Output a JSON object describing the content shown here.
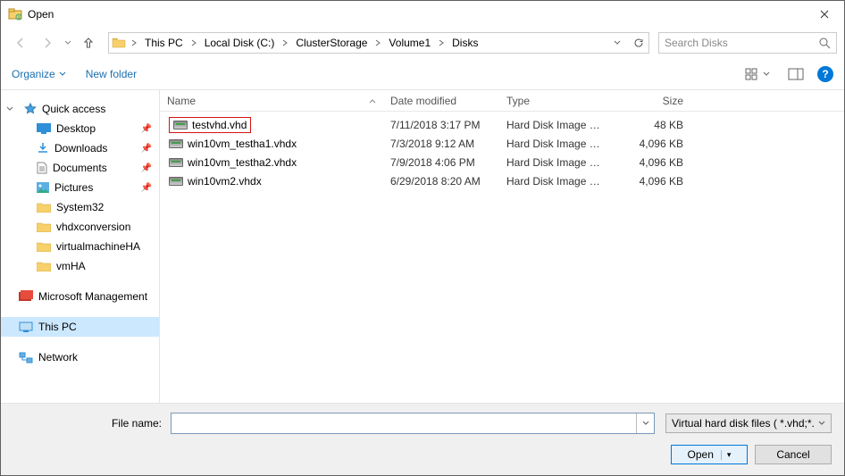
{
  "window": {
    "title": "Open"
  },
  "breadcrumbs": {
    "b0": "This PC",
    "b1": "Local Disk (C:)",
    "b2": "ClusterStorage",
    "b3": "Volume1",
    "b4": "Disks"
  },
  "search": {
    "placeholder": "Search Disks"
  },
  "toolbar": {
    "organize": "Organize",
    "new_folder": "New folder"
  },
  "nav": {
    "quick_access": "Quick access",
    "desktop": "Desktop",
    "downloads": "Downloads",
    "documents": "Documents",
    "pictures": "Pictures",
    "system32": "System32",
    "vhdxconversion": "vhdxconversion",
    "virtualmachineHA": "virtualmachineHA",
    "vmHA": "vmHA",
    "mmc": "Microsoft Management",
    "this_pc": "This PC",
    "network": "Network"
  },
  "columns": {
    "name": "Name",
    "date": "Date modified",
    "type": "Type",
    "size": "Size"
  },
  "files": {
    "r0": {
      "name": "testvhd.vhd",
      "date": "7/11/2018 3:17 PM",
      "type": "Hard Disk Image F...",
      "size": "48 KB"
    },
    "r1": {
      "name": "win10vm_testha1.vhdx",
      "date": "7/3/2018 9:12 AM",
      "type": "Hard Disk Image F...",
      "size": "4,096 KB"
    },
    "r2": {
      "name": "win10vm_testha2.vhdx",
      "date": "7/9/2018 4:06 PM",
      "type": "Hard Disk Image F...",
      "size": "4,096 KB"
    },
    "r3": {
      "name": "win10vm2.vhdx",
      "date": "6/29/2018 8:20 AM",
      "type": "Hard Disk Image F...",
      "size": "4,096 KB"
    }
  },
  "footer": {
    "filename_label": "File name:",
    "filename_value": "",
    "filter": "Virtual hard disk files  ( *.vhd;*.",
    "open": "Open",
    "cancel": "Cancel"
  }
}
